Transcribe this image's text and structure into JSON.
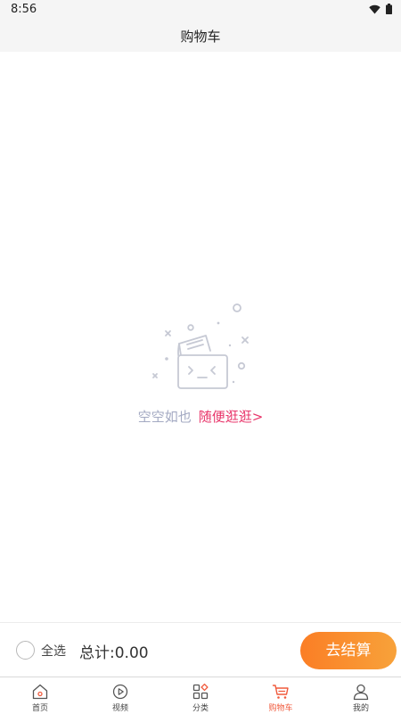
{
  "status_bar": {
    "time": "8:56"
  },
  "header": {
    "title": "购物车"
  },
  "empty_state": {
    "label": "空空如也",
    "link": "随便逛逛>"
  },
  "checkout": {
    "select_all": "全选",
    "total": "总计:0.00",
    "button": "去结算"
  },
  "tabs": [
    {
      "label": "首页",
      "icon": "home-icon"
    },
    {
      "label": "视频",
      "icon": "play-icon"
    },
    {
      "label": "分类",
      "icon": "category-icon"
    },
    {
      "label": "购物车",
      "icon": "cart-icon",
      "active": true
    },
    {
      "label": "我的",
      "icon": "user-icon"
    }
  ],
  "colors": {
    "accent": "#f05a3c",
    "link": "#e8356a",
    "button_start": "#fb7e25",
    "button_end": "#f8a23a"
  }
}
